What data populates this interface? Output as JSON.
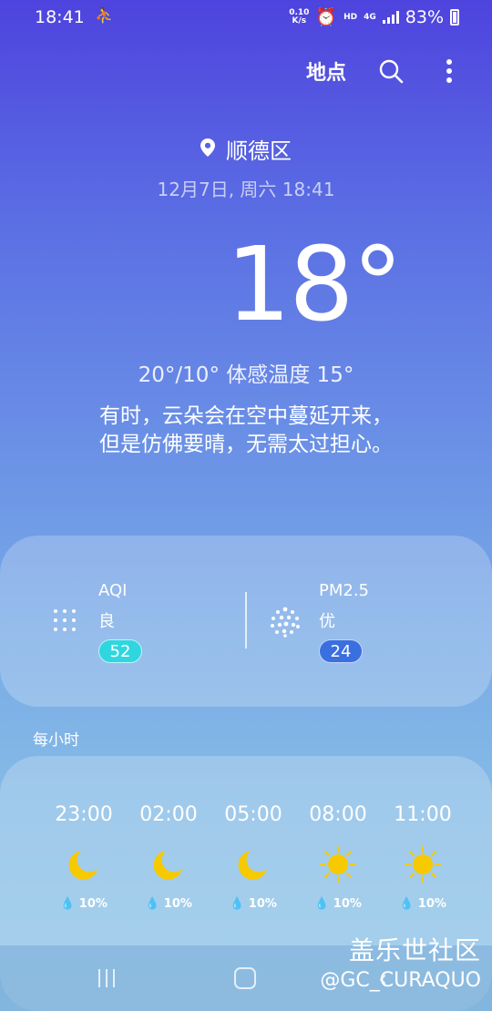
{
  "status_bar": {
    "time": "18:41",
    "speed_value": "0.10",
    "speed_unit": "K/s",
    "hd": "HD",
    "network": "4G",
    "battery": "83%"
  },
  "header": {
    "locations_label": "地点"
  },
  "current": {
    "location": "顺德区",
    "datetime": "12月7日, 周六 18:41",
    "temperature": "18°",
    "range_feels": "20°/10° 体感温度 15°",
    "description_line1": "有时，云朵会在空中蔓延开来，",
    "description_line2": "但是仿佛要晴，无需太过担心。"
  },
  "air_quality": {
    "aqi": {
      "label": "AQI",
      "grade": "良",
      "value": "52"
    },
    "pm25": {
      "label": "PM2.5",
      "grade": "优",
      "value": "24"
    }
  },
  "hourly": {
    "title": "每小时",
    "items": [
      {
        "time": "23:00",
        "icon": "moon-icon",
        "rain": "10%"
      },
      {
        "time": "02:00",
        "icon": "moon-icon",
        "rain": "10%"
      },
      {
        "time": "05:00",
        "icon": "moon-icon",
        "rain": "10%"
      },
      {
        "time": "08:00",
        "icon": "sun-icon",
        "rain": "10%"
      },
      {
        "time": "11:00",
        "icon": "sun-icon",
        "rain": "10%"
      }
    ]
  },
  "watermark": {
    "line1": "盖乐世社区",
    "line2": "@GC_CURAQUO"
  },
  "colors": {
    "moon": "#f7c900",
    "sun": "#f7c900",
    "aqi_pill": "#2fd6e0",
    "pm_pill": "#3a6fe0"
  }
}
